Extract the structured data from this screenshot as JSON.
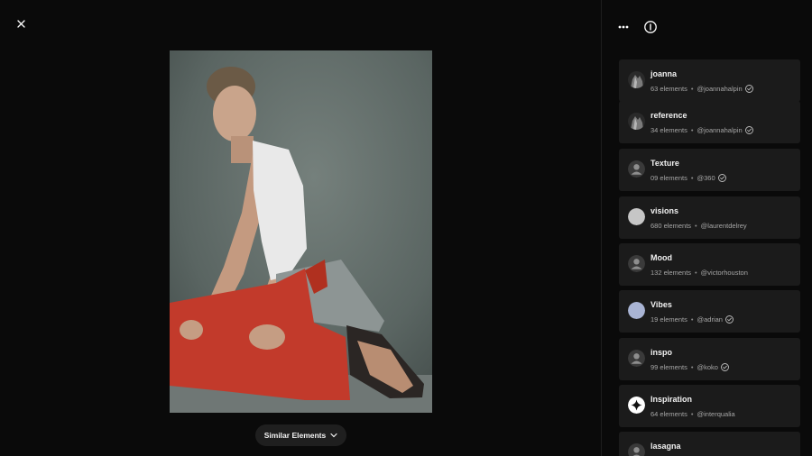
{
  "viewer": {
    "close_icon": "close-icon",
    "similar_label": "Similar Elements",
    "similar_icon": "chevron-down-icon"
  },
  "toolbar": {
    "more_icon": "more-horizontal-icon",
    "info_icon": "info-icon"
  },
  "channels": [
    {
      "title": "joanna",
      "count": "63 elements",
      "handle": "@joannahalpin",
      "verified": true,
      "avatar": "photo"
    },
    {
      "title": "reference",
      "count": "34 elements",
      "handle": "@joannahalpin",
      "verified": true,
      "avatar": "photo"
    },
    {
      "title": "Texture",
      "count": "09 elements",
      "handle": "@360",
      "verified": true,
      "avatar": "default"
    },
    {
      "title": "visions",
      "count": "680 elements",
      "handle": "@laurentdelrey",
      "verified": false,
      "avatar": "light-gray"
    },
    {
      "title": "Mood",
      "count": "132 elements",
      "handle": "@victorhouston",
      "verified": false,
      "avatar": "default"
    },
    {
      "title": "Vibes",
      "count": "19 elements",
      "handle": "@adrian",
      "verified": true,
      "avatar": "periwinkle"
    },
    {
      "title": "inspo",
      "count": "99 elements",
      "handle": "@koko",
      "verified": true,
      "avatar": "default"
    },
    {
      "title": "Inspiration",
      "count": "64 elements",
      "handle": "@interqualia",
      "verified": false,
      "avatar": "sparkle"
    },
    {
      "title": "lasagna",
      "count": "",
      "handle": "",
      "verified": false,
      "avatar": "default"
    }
  ],
  "colors": {
    "background": "#0a0a0a",
    "card": "#1b1b1b",
    "photo_backdrop": "#5c6764",
    "trousers": "#c23a2b"
  }
}
